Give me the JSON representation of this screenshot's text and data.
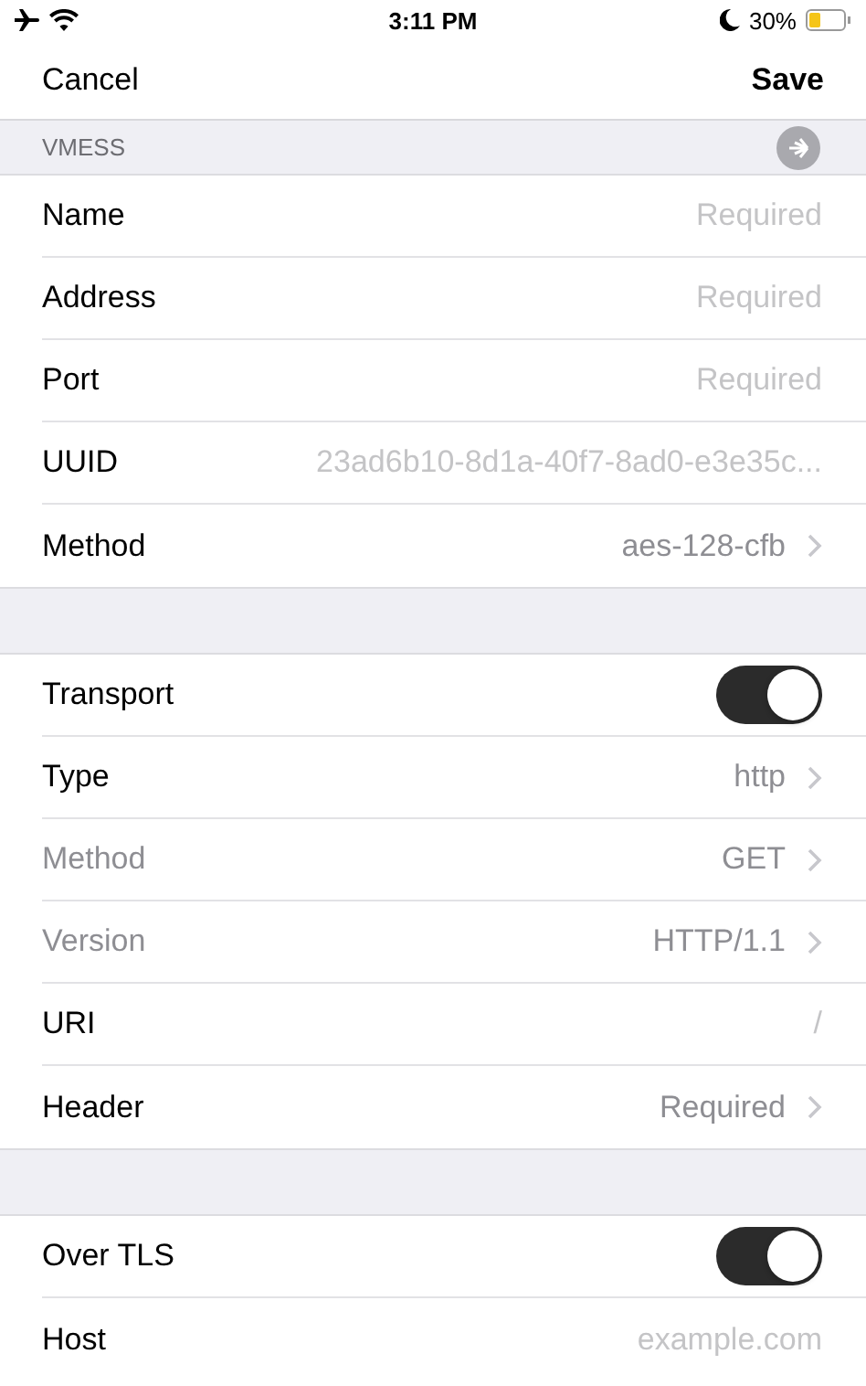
{
  "status_bar": {
    "time": "3:11 PM",
    "battery": "30%"
  },
  "nav": {
    "cancel": "Cancel",
    "save": "Save"
  },
  "sections": [
    {
      "header": "VMESS",
      "rows": [
        {
          "kind": "field",
          "label": "Name",
          "placeholder": "Required",
          "disabled": false
        },
        {
          "kind": "field",
          "label": "Address",
          "placeholder": "Required",
          "disabled": false
        },
        {
          "kind": "field",
          "label": "Port",
          "placeholder": "Required",
          "disabled": false
        },
        {
          "kind": "field",
          "label": "UUID",
          "placeholder": "23ad6b10-8d1a-40f7-8ad0-e3e35c...",
          "disabled": false
        },
        {
          "kind": "select",
          "label": "Method",
          "value": "aes-128-cfb",
          "disabled": false
        }
      ]
    },
    {
      "rows": [
        {
          "kind": "toggle",
          "label": "Transport",
          "on": true,
          "disabled": false
        },
        {
          "kind": "select",
          "label": "Type",
          "value": "http",
          "disabled": false
        },
        {
          "kind": "select",
          "label": "Method",
          "value": "GET",
          "disabled": true
        },
        {
          "kind": "select",
          "label": "Version",
          "value": "HTTP/1.1",
          "disabled": true
        },
        {
          "kind": "field",
          "label": "URI",
          "placeholder": "/",
          "disabled": false
        },
        {
          "kind": "select",
          "label": "Header",
          "value": "Required",
          "disabled": false
        }
      ]
    },
    {
      "rows": [
        {
          "kind": "toggle",
          "label": "Over TLS",
          "on": true,
          "disabled": false
        },
        {
          "kind": "field",
          "label": "Host",
          "placeholder": "example.com",
          "disabled": false
        }
      ]
    }
  ]
}
